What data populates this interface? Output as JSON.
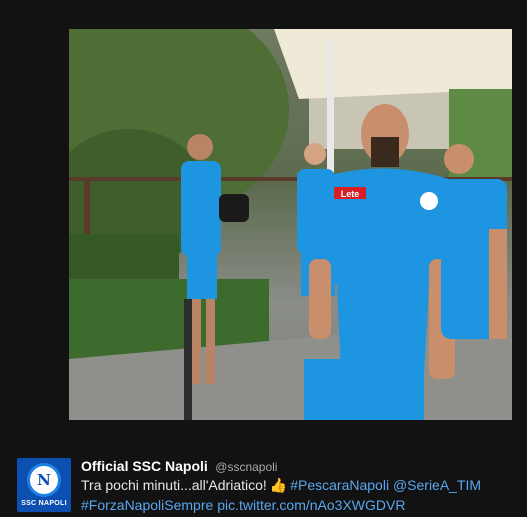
{
  "photo": {
    "description_icon": "photo-image",
    "jersey_color": "#1e95e0",
    "sponsor_label": "Lete"
  },
  "tweet": {
    "avatar_letter": "N",
    "avatar_text": "SSC NAPOLI",
    "display_name": "Official SSC Napoli",
    "handle": "@sscnapoli",
    "text_part1": "Tra pochi minuti...all'Adriatico!",
    "emoji": "👍",
    "hashtag1": "#PescaraNapoli",
    "mention1": "@SerieA_TIM",
    "hashtag2": "#ForzaNapoliSempre",
    "pic_link": "pic.twitter.com/nAo3XWGDVR"
  },
  "colors": {
    "background": "#121212",
    "link": "#5aa6ee",
    "brand": "#0d4fb0"
  }
}
